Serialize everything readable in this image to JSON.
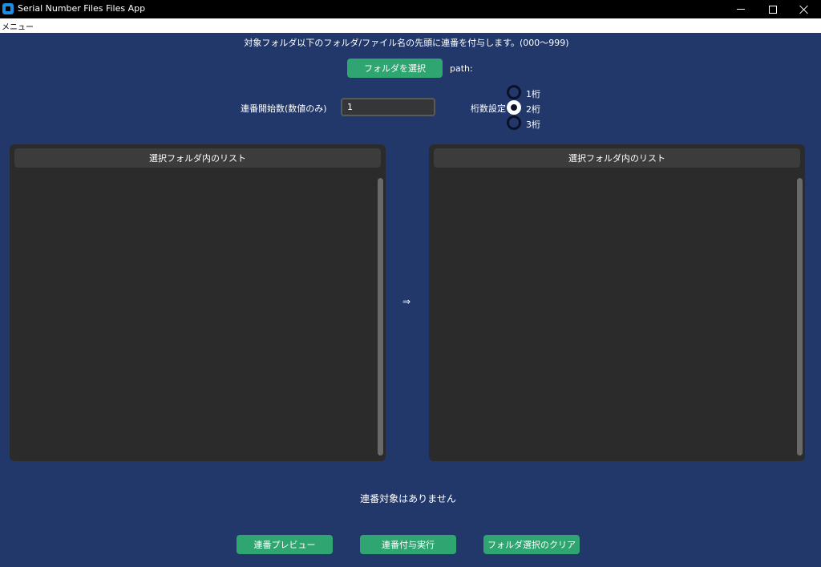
{
  "window": {
    "title": "Serial Number Files Files App"
  },
  "menubar": {
    "menu_label": "メニュー"
  },
  "description": "対象フォルダ以下のフォルダ/ファイル名の先頭に連番を付与します。(000〜999)",
  "folder_select": {
    "button_label": "フォルダを選択",
    "path_label": "path:"
  },
  "start_number": {
    "label": "連番開始数(数値のみ)",
    "value": "1"
  },
  "digits": {
    "label": "桁数設定",
    "options": [
      "1桁",
      "2桁",
      "3桁"
    ],
    "selected": "2桁"
  },
  "left_list": {
    "header": "選択フォルダ内のリスト"
  },
  "right_list": {
    "header": "選択フォルダ内のリスト"
  },
  "arrow": "⇒",
  "status_text": "連番対象はありません",
  "actions": {
    "preview_label": "連番プレビュー",
    "execute_label": "連番付与実行",
    "clear_label": "フォルダ選択のクリア"
  },
  "colors": {
    "background": "#22386b",
    "accent": "#2fa572",
    "panel": "#2b2b2b"
  }
}
